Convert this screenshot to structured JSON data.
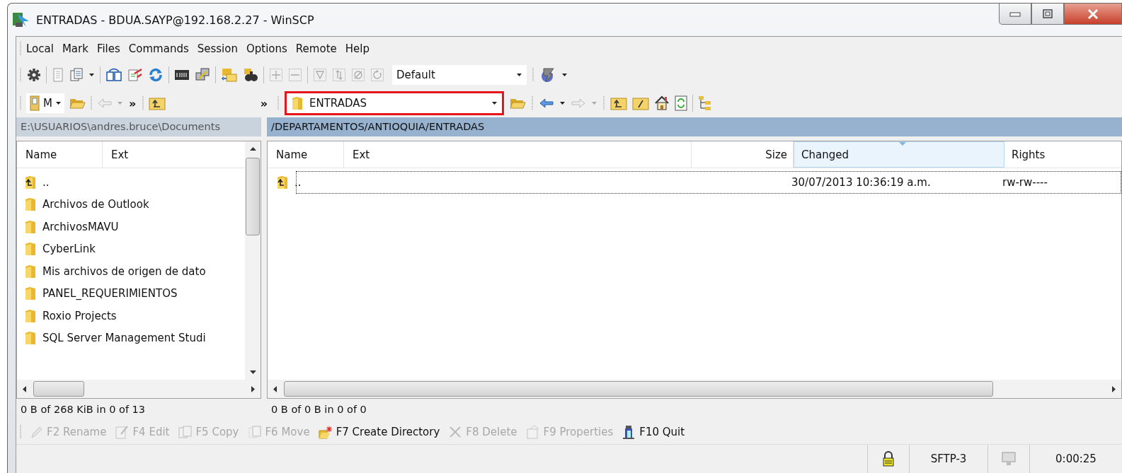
{
  "window": {
    "title": "ENTRADAS - BDUA.SAYP@192.168.2.27 - WinSCP"
  },
  "menu": [
    "Local",
    "Mark",
    "Files",
    "Commands",
    "Session",
    "Options",
    "Remote",
    "Help"
  ],
  "toolbar": {
    "transfer_settings": "Default"
  },
  "local_toolbar": {
    "drive": "M",
    "chevrons": [
      "»",
      "»"
    ]
  },
  "remote_toolbar": {
    "directory": "ENTRADAS",
    "highlighted": true
  },
  "local_panel": {
    "path": "E:\\USUARIOS\\andres.bruce\\Documents",
    "active": false,
    "columns": [
      {
        "label": "Name",
        "sorted": false
      },
      {
        "label": "Ext",
        "sorted": false
      }
    ],
    "rows": [
      {
        "kind": "parent",
        "name": ".."
      },
      {
        "kind": "folder",
        "name": "Archivos de Outlook"
      },
      {
        "kind": "folder",
        "name": "ArchivosMAVU"
      },
      {
        "kind": "folder",
        "name": "CyberLink"
      },
      {
        "kind": "folder",
        "name": "Mis archivos de origen de dato"
      },
      {
        "kind": "folder",
        "name": "PANEL_REQUERIMIENTOS"
      },
      {
        "kind": "folder",
        "name": "Roxio Projects"
      },
      {
        "kind": "folder",
        "name": "SQL Server Management Studi"
      }
    ],
    "status": "0 B of 268 KiB in 0 of 13"
  },
  "remote_panel": {
    "path": "/DEPARTAMENTOS/ANTIOQUIA/ENTRADAS",
    "active": true,
    "columns": [
      {
        "label": "Name",
        "sorted": false
      },
      {
        "label": "Ext",
        "sorted": false
      },
      {
        "label": "Size",
        "sorted": false
      },
      {
        "label": "Changed",
        "sorted": true
      },
      {
        "label": "Rights",
        "sorted": false
      }
    ],
    "rows": [
      {
        "kind": "parent",
        "name": "..",
        "changed": "30/07/2013 10:36:19 a.m.",
        "rights": "rw-rw----",
        "focused": true
      }
    ],
    "status": "0 B of 0 B in 0 of 0"
  },
  "commands": [
    {
      "kind": "rename",
      "label": "F2 Rename",
      "disabled": true
    },
    {
      "kind": "edit",
      "label": "F4 Edit",
      "disabled": true
    },
    {
      "kind": "copy",
      "label": "F5 Copy",
      "disabled": true
    },
    {
      "kind": "move",
      "label": "F6 Move",
      "disabled": true
    },
    {
      "kind": "mkdir",
      "label": "F7 Create Directory",
      "disabled": false
    },
    {
      "kind": "delete",
      "label": "F8 Delete",
      "disabled": true
    },
    {
      "kind": "properties",
      "label": "F9 Properties",
      "disabled": true
    },
    {
      "kind": "quit",
      "label": "F10 Quit",
      "disabled": false
    }
  ],
  "status_bar": {
    "protocol": "SFTP-3",
    "elapsed": "0:00:25"
  }
}
